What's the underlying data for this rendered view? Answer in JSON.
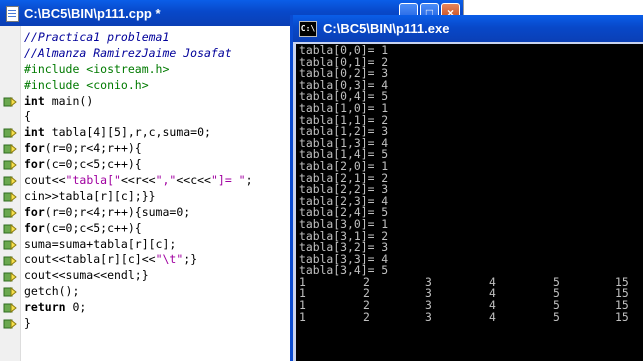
{
  "editor": {
    "title": "C:\\BC5\\BIN\\p111.cpp *",
    "lines": [
      {
        "parts": [
          {
            "c": "cm",
            "t": "//Practica1 problema1"
          }
        ]
      },
      {
        "parts": [
          {
            "c": "cm",
            "t": "//Almanza RamirezJaime Josafat"
          }
        ]
      },
      {
        "parts": [
          {
            "c": "pp",
            "t": "#include <iostream.h>"
          }
        ]
      },
      {
        "parts": [
          {
            "c": "pp",
            "t": "#include <conio.h>"
          }
        ]
      },
      {
        "parts": [
          {
            "c": "kw",
            "t": "int"
          },
          {
            "c": "txt",
            "t": " main()"
          }
        ]
      },
      {
        "parts": [
          {
            "c": "txt",
            "t": "{"
          }
        ]
      },
      {
        "parts": [
          {
            "c": "kw",
            "t": "int"
          },
          {
            "c": "txt",
            "t": " tabla[4][5],r,c,suma="
          },
          {
            "c": "nm",
            "t": "0"
          },
          {
            "c": "txt",
            "t": ";"
          }
        ]
      },
      {
        "parts": [
          {
            "c": "kw",
            "t": "for"
          },
          {
            "c": "txt",
            "t": "(r=0;r<4;r++){"
          }
        ]
      },
      {
        "parts": [
          {
            "c": "kw",
            "t": "for"
          },
          {
            "c": "txt",
            "t": "(c=0;c<5;c++){"
          }
        ]
      },
      {
        "parts": [
          {
            "c": "txt",
            "t": "cout<<"
          },
          {
            "c": "st",
            "t": "\"tabla[\""
          },
          {
            "c": "txt",
            "t": "<<r<<"
          },
          {
            "c": "st",
            "t": "\",\""
          },
          {
            "c": "txt",
            "t": "<<c<<"
          },
          {
            "c": "st",
            "t": "\"]= \""
          },
          {
            "c": "txt",
            "t": ";"
          }
        ]
      },
      {
        "parts": [
          {
            "c": "txt",
            "t": "cin>>tabla[r][c];}}"
          }
        ]
      },
      {
        "parts": [
          {
            "c": "kw",
            "t": "for"
          },
          {
            "c": "txt",
            "t": "(r=0;r<4;r++){suma=0;"
          }
        ]
      },
      {
        "parts": [
          {
            "c": "kw",
            "t": "for"
          },
          {
            "c": "txt",
            "t": "(c=0;c<5;c++){"
          }
        ]
      },
      {
        "parts": [
          {
            "c": "txt",
            "t": "suma=suma+tabla[r][c];"
          }
        ]
      },
      {
        "parts": [
          {
            "c": "txt",
            "t": "cout<<tabla[r][c]<<"
          },
          {
            "c": "st",
            "t": "\"\\t\""
          },
          {
            "c": "txt",
            "t": ";}"
          }
        ]
      },
      {
        "parts": [
          {
            "c": "txt",
            "t": "cout<<suma<<endl;}"
          }
        ]
      },
      {
        "parts": [
          {
            "c": "txt",
            "t": "getch();"
          }
        ]
      },
      {
        "parts": [
          {
            "c": "kw",
            "t": "return"
          },
          {
            "c": "txt",
            "t": " 0;"
          }
        ]
      },
      {
        "parts": [
          {
            "c": "txt",
            "t": "}"
          }
        ]
      }
    ],
    "breakpoint_rows": [
      4,
      6,
      7,
      8,
      9,
      10,
      11,
      12,
      13,
      14,
      15,
      16,
      17,
      18
    ]
  },
  "console": {
    "title": "C:\\BC5\\BIN\\p111.exe",
    "icon_text": "C:\\",
    "input_lines": [
      "tabla[0,0]= 1",
      "tabla[0,1]= 2",
      "tabla[0,2]= 3",
      "tabla[0,3]= 4",
      "tabla[0,4]= 5",
      "tabla[1,0]= 1",
      "tabla[1,1]= 2",
      "tabla[1,2]= 3",
      "tabla[1,3]= 4",
      "tabla[1,4]= 5",
      "tabla[2,0]= 1",
      "tabla[2,1]= 2",
      "tabla[2,2]= 3",
      "tabla[2,3]= 4",
      "tabla[2,4]= 5",
      "tabla[3,0]= 1",
      "tabla[3,1]= 2",
      "tabla[3,2]= 3",
      "tabla[3,3]= 4",
      "tabla[3,4]= 5"
    ],
    "result_rows": [
      [
        "1",
        "2",
        "3",
        "4",
        "5",
        "15"
      ],
      [
        "1",
        "2",
        "3",
        "4",
        "5",
        "15"
      ],
      [
        "1",
        "2",
        "3",
        "4",
        "5",
        "15"
      ],
      [
        "1",
        "2",
        "3",
        "4",
        "5",
        "15"
      ]
    ]
  },
  "window_buttons": {
    "minimize": "_",
    "maximize": "□",
    "close": "×"
  }
}
